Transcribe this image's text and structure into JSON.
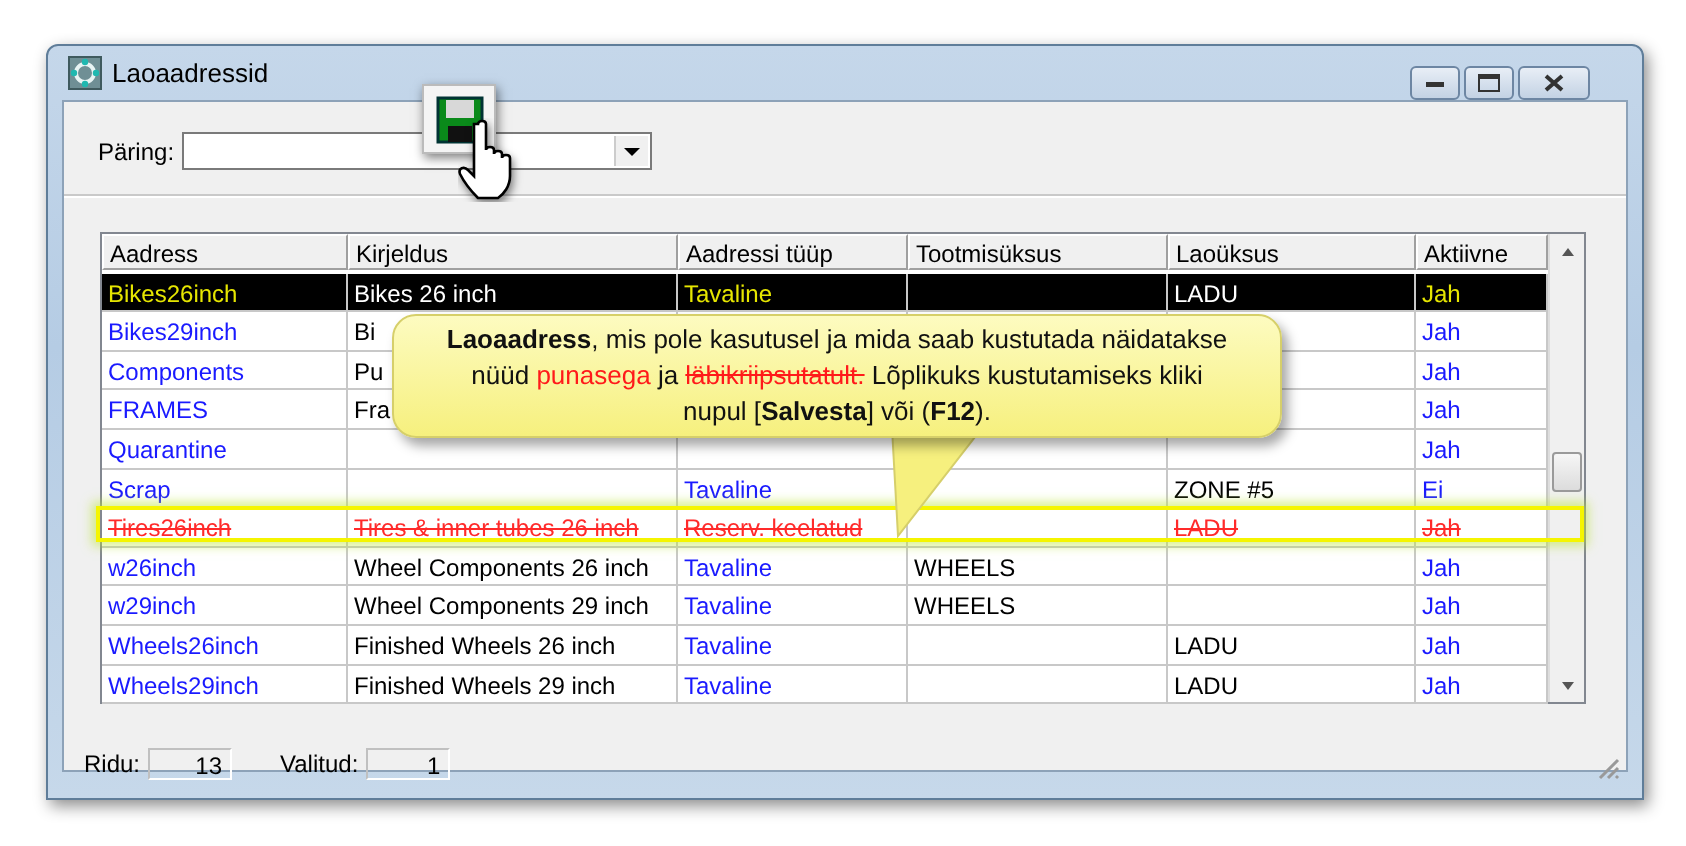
{
  "window": {
    "title": "Laoaadressid"
  },
  "query": {
    "label": "Päring:"
  },
  "table": {
    "columns": [
      {
        "label": "Aadress",
        "kind": "coded"
      },
      {
        "label": "Kirjeldus",
        "kind": "plain"
      },
      {
        "label": "Aadressi tüüp",
        "kind": "coded"
      },
      {
        "label": "Tootmisüksus",
        "kind": "plain"
      },
      {
        "label": "Laoüksus",
        "kind": "plain"
      },
      {
        "label": "Aktiivne",
        "kind": "coded"
      }
    ],
    "rows": [
      {
        "cells": [
          "Bikes26inch",
          "Bikes 26 inch",
          "Tavaline",
          null,
          "LADU",
          "Jah"
        ],
        "selected": true,
        "deleted": false
      },
      {
        "cells": [
          "Bikes29inch",
          "Bi",
          null,
          null,
          null,
          "Jah"
        ],
        "selected": false,
        "deleted": false
      },
      {
        "cells": [
          "Components",
          "Pu",
          null,
          null,
          null,
          "Jah"
        ],
        "selected": false,
        "deleted": false
      },
      {
        "cells": [
          "FRAMES",
          "Fra",
          null,
          null,
          null,
          "Jah"
        ],
        "selected": false,
        "deleted": false
      },
      {
        "cells": [
          "Quarantine",
          null,
          null,
          null,
          null,
          "Jah"
        ],
        "selected": false,
        "deleted": false
      },
      {
        "cells": [
          "Scrap",
          null,
          "Tavaline",
          null,
          "ZONE #5",
          "Ei"
        ],
        "selected": false,
        "deleted": false
      },
      {
        "cells": [
          "Tires26inch",
          "Tires & inner tubes 26 inch",
          "Reserv. keelatud",
          null,
          "LADU",
          "Jah"
        ],
        "selected": false,
        "deleted": true
      },
      {
        "cells": [
          "w26inch",
          "Wheel Components 26 inch",
          "Tavaline",
          "WHEELS",
          null,
          "Jah"
        ],
        "selected": false,
        "deleted": false
      },
      {
        "cells": [
          "w29inch",
          "Wheel Components 29 inch",
          "Tavaline",
          "WHEELS",
          null,
          "Jah"
        ],
        "selected": false,
        "deleted": false
      },
      {
        "cells": [
          "Wheels26inch",
          "Finished Wheels 26 inch",
          "Tavaline",
          null,
          "LADU",
          "Jah"
        ],
        "selected": false,
        "deleted": false
      },
      {
        "cells": [
          "Wheels29inch",
          "Finished Wheels 29 inch",
          "Tavaline",
          null,
          "LADU",
          "Jah"
        ],
        "selected": false,
        "deleted": false
      }
    ]
  },
  "status_bar": {
    "rows_label": "Ridu:",
    "rows_value": "13",
    "selected_label": "Valitud:",
    "selected_value": "1"
  },
  "callout": {
    "segments": [
      {
        "kind": "plain",
        "text": "**Laoaadress**, mis pole kasutusel ja mida saab kustutada näidatakse nüüd "
      },
      {
        "kind": "red",
        "text": "punasega"
      },
      {
        "kind": "plain",
        "text": " ja "
      },
      {
        "kind": "struck",
        "text": "läbikriipsutatult."
      },
      {
        "kind": "plain",
        "text": " Lõplikuks kustutamiseks kliki nupul [**Salvesta**] või (**F12**)."
      }
    ]
  }
}
